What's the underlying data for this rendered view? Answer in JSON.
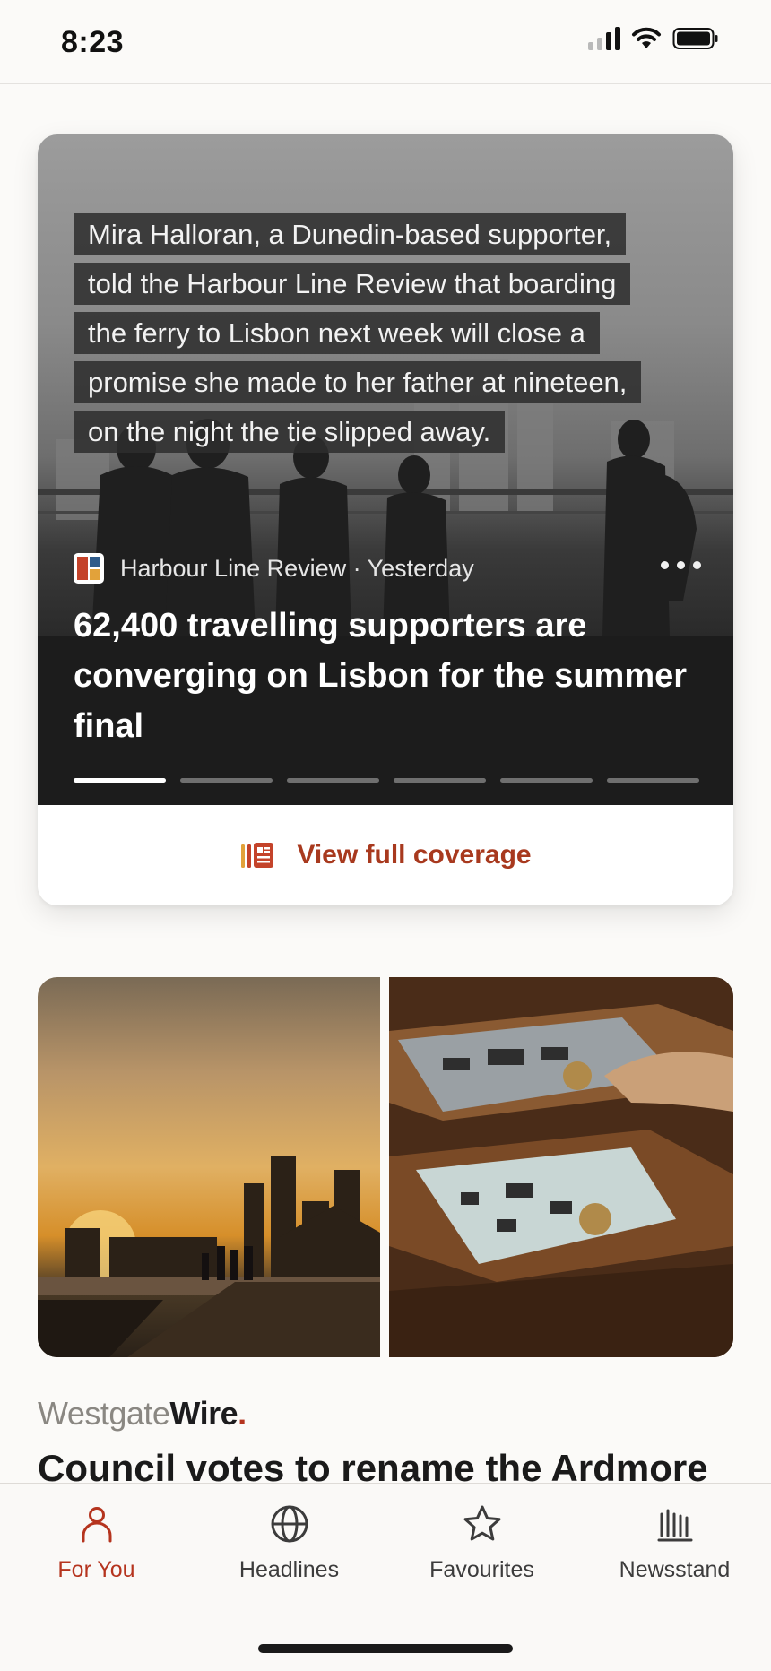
{
  "status_bar": {
    "time": "8:23"
  },
  "hero": {
    "quote_lines": [
      "Mira Halloran, a Dunedin-based supporter,",
      "told the Harbour Line Review that boarding",
      "the ferry to Lisbon next week will close a",
      "promise she made to her father at nineteen,",
      "on the night the tie slipped away."
    ],
    "source": "Harbour Line Review · Yesterday",
    "title": "62,400 travelling supporters are converging on Lisbon for the summer final",
    "progress_segments": 6,
    "active_segment": 1,
    "coverage_label": "View full coverage"
  },
  "story2": {
    "brand_light": "Westgate",
    "brand_bold": "Wire",
    "brand_dot": ".",
    "title": "Council votes to rename the Ardmore"
  },
  "tabs": [
    {
      "label": "For You",
      "icon": "person-icon",
      "active": true
    },
    {
      "label": "Headlines",
      "icon": "globe-icon",
      "active": false
    },
    {
      "label": "Favourites",
      "icon": "star-icon",
      "active": false
    },
    {
      "label": "Newsstand",
      "icon": "newsstand-icon",
      "active": false
    }
  ],
  "colors": {
    "accent": "#b5341e",
    "coverage": "#a8391e",
    "background": "#fbfaf8"
  }
}
